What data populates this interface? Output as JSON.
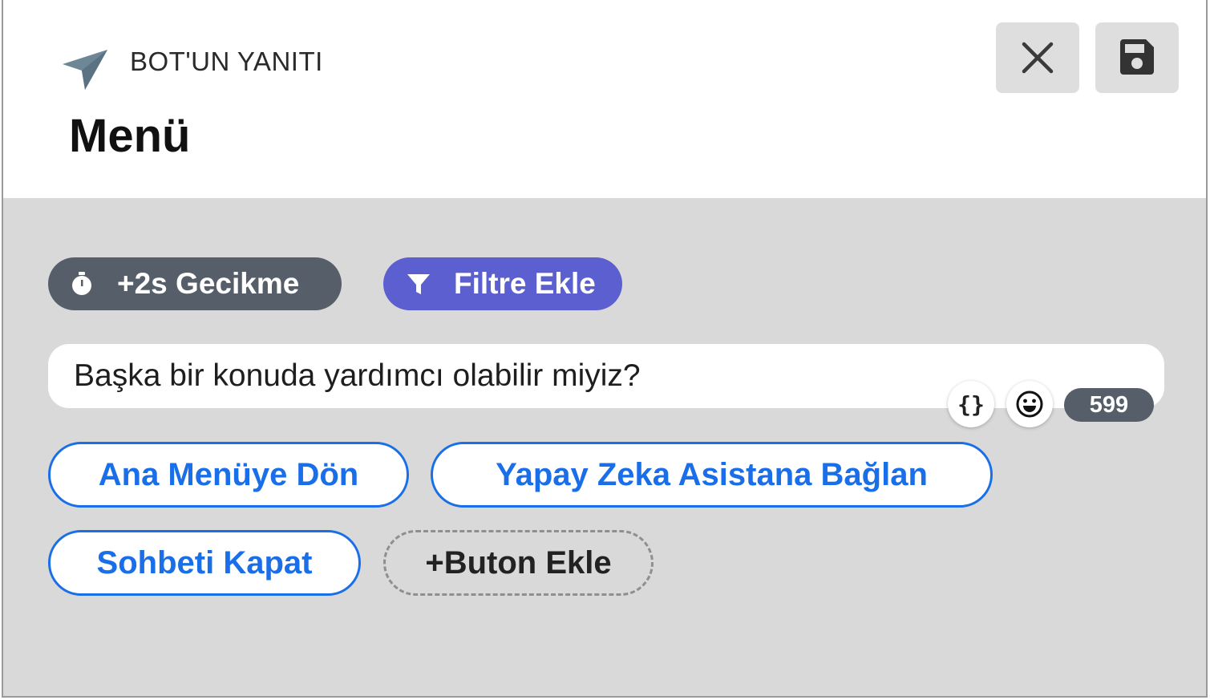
{
  "header": {
    "label": "BOT'UN YANITI",
    "title": "Menü",
    "send_icon": "paper-plane-icon",
    "close_icon": "close-icon",
    "save_icon": "save-icon"
  },
  "tags": {
    "delay": {
      "label": "+2s Gecikme",
      "icon": "stopwatch-icon",
      "color": "#565e69"
    },
    "filter": {
      "label": "Filtre Ekle",
      "icon": "filter-icon",
      "color": "#5b5fcf"
    }
  },
  "message": {
    "text": "Başka bir konuda yardımcı olabilir miyiz?",
    "vars_label": "{}",
    "emoji_icon": "emoji-icon",
    "remaining_chars": "599"
  },
  "buttons": [
    {
      "label": "Ana Menüye Dön"
    },
    {
      "label": "Yapay Zeka Asistana Bağlan"
    },
    {
      "label": "Sohbeti Kapat"
    }
  ],
  "add_button_label": "+Buton Ekle",
  "colors": {
    "accent_blue": "#1a6fe8",
    "panel_gray": "#d9d9d9"
  }
}
